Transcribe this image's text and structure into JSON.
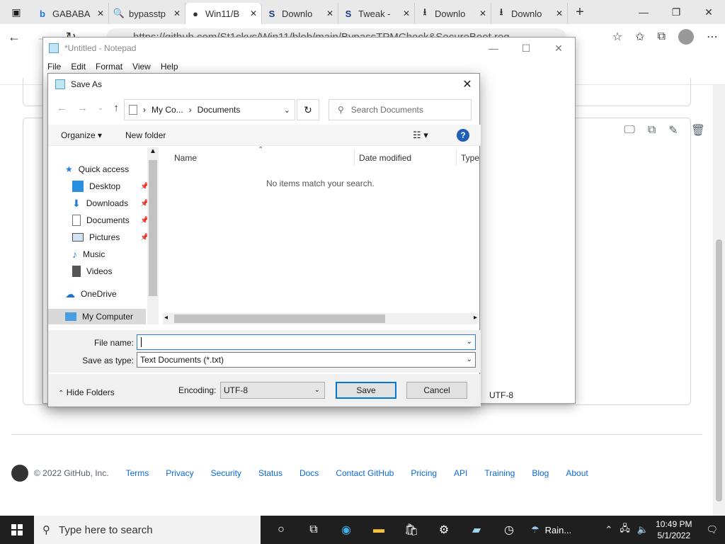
{
  "browser": {
    "tabs": [
      {
        "icon": "b",
        "label": "GABABA",
        "active": false
      },
      {
        "icon": "🔍",
        "label": "bypasstp",
        "active": false
      },
      {
        "icon": "●",
        "label": "Win11/B",
        "active": true
      },
      {
        "icon": "S",
        "label": "Downlo",
        "active": false
      },
      {
        "icon": "S",
        "label": "Tweak -",
        "active": false
      },
      {
        "icon": "⭳",
        "label": "Downlo",
        "active": false
      },
      {
        "icon": "⭳",
        "label": "Downlo",
        "active": false
      }
    ],
    "url": "https://github.com/St1ckys/Win11/blob/main/BypassTPMCheck&SecureBoot.reg"
  },
  "github": {
    "footer": {
      "copyright": "© 2022 GitHub, Inc.",
      "links": [
        "Terms",
        "Privacy",
        "Security",
        "Status",
        "Docs",
        "Contact GitHub",
        "Pricing",
        "API",
        "Training",
        "Blog",
        "About"
      ]
    }
  },
  "notepad": {
    "title": "*Untitled - Notepad",
    "menu": [
      "File",
      "Edit",
      "Format",
      "View",
      "Help"
    ],
    "status_encoding": "UTF-8"
  },
  "dialog": {
    "title": "Save As",
    "breadcrumb": [
      "My Co...",
      "Documents"
    ],
    "search_placeholder": "Search Documents",
    "organize_label": "Organize",
    "new_folder_label": "New folder",
    "nav_items": [
      {
        "label": "Quick access",
        "icon": "star-icon",
        "pinned": false
      },
      {
        "label": "Desktop",
        "icon": "desktop-icon",
        "pinned": true
      },
      {
        "label": "Downloads",
        "icon": "download-icon",
        "pinned": true
      },
      {
        "label": "Documents",
        "icon": "document-icon",
        "pinned": true
      },
      {
        "label": "Pictures",
        "icon": "picture-icon",
        "pinned": true
      },
      {
        "label": "Music",
        "icon": "music-icon",
        "pinned": false
      },
      {
        "label": "Videos",
        "icon": "video-icon",
        "pinned": false
      },
      {
        "label": "OneDrive",
        "icon": "cloud-icon",
        "pinned": false
      },
      {
        "label": "My Computer",
        "icon": "computer-icon",
        "pinned": false
      }
    ],
    "columns": [
      "Name",
      "Date modified",
      "Type"
    ],
    "empty_message": "No items match your search.",
    "file_name_label": "File name:",
    "file_name_value": "",
    "save_as_type_label": "Save as type:",
    "save_as_type_value": "Text Documents (*.txt)",
    "hide_folders_label": "Hide Folders",
    "encoding_label": "Encoding:",
    "encoding_value": "UTF-8",
    "save_label": "Save",
    "cancel_label": "Cancel"
  },
  "taskbar": {
    "search_placeholder": "Type here to search",
    "weather": "Rain...",
    "time": "10:49 PM",
    "date": "5/1/2022"
  },
  "colors": {
    "accent": "#0078d7",
    "link": "#0969da",
    "taskbar": "#1f1f1f"
  }
}
